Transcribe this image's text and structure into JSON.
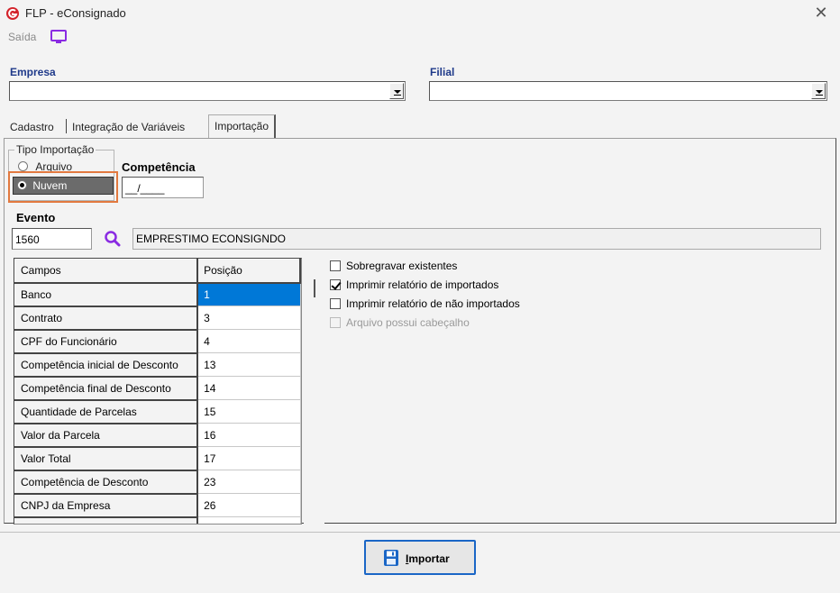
{
  "window": {
    "title": "FLP - eConsignado",
    "close_label": "✕"
  },
  "menu": {
    "exit_label": "Saída"
  },
  "empresa": {
    "label": "Empresa",
    "value": ""
  },
  "filial": {
    "label": "Filial",
    "value": ""
  },
  "tabs": [
    {
      "label": "Cadastro"
    },
    {
      "label": "Integração de Variáveis"
    },
    {
      "label": "Importação"
    }
  ],
  "tipo_importacao": {
    "label": "Tipo Importação",
    "options": [
      {
        "label": "Arquivo",
        "selected": false
      },
      {
        "label": "Nuvem",
        "selected": true
      }
    ]
  },
  "competencia": {
    "label": "Competência",
    "value": "__/____"
  },
  "evento": {
    "label": "Evento",
    "code": "1560",
    "description": "EMPRESTIMO ECONSIGNDO"
  },
  "grid": {
    "headers": [
      "Campos",
      "Posição"
    ],
    "rows": [
      {
        "campo": "Banco",
        "posicao": "1",
        "selected": true
      },
      {
        "campo": "Contrato",
        "posicao": "3"
      },
      {
        "campo": "CPF do Funcionário",
        "posicao": "4"
      },
      {
        "campo": "Competência inicial de Desconto",
        "posicao": "13"
      },
      {
        "campo": "Competência final de Desconto",
        "posicao": "14"
      },
      {
        "campo": "Quantidade de Parcelas",
        "posicao": "15"
      },
      {
        "campo": "Valor da Parcela",
        "posicao": "16"
      },
      {
        "campo": "Valor Total",
        "posicao": "17"
      },
      {
        "campo": "Competência de Desconto",
        "posicao": "23"
      },
      {
        "campo": "CNPJ da Empresa",
        "posicao": "26"
      }
    ]
  },
  "options": [
    {
      "label": "Sobregravar existentes",
      "checked": false,
      "enabled": true
    },
    {
      "label": "Imprimir relatório de importados",
      "checked": true,
      "enabled": true
    },
    {
      "label": "Imprimir relatório de não importados",
      "checked": false,
      "enabled": true
    },
    {
      "label": "Arquivo possui cabeçalho",
      "checked": false,
      "enabled": false
    }
  ],
  "import_button": {
    "label_first": "I",
    "label_rest": "mportar"
  },
  "colors": {
    "accent": "#0078d7",
    "label_blue": "#1f3a8a",
    "highlight": "#e2793f",
    "brand_red": "#d3222a",
    "monitor_purple": "#8a2be2"
  }
}
